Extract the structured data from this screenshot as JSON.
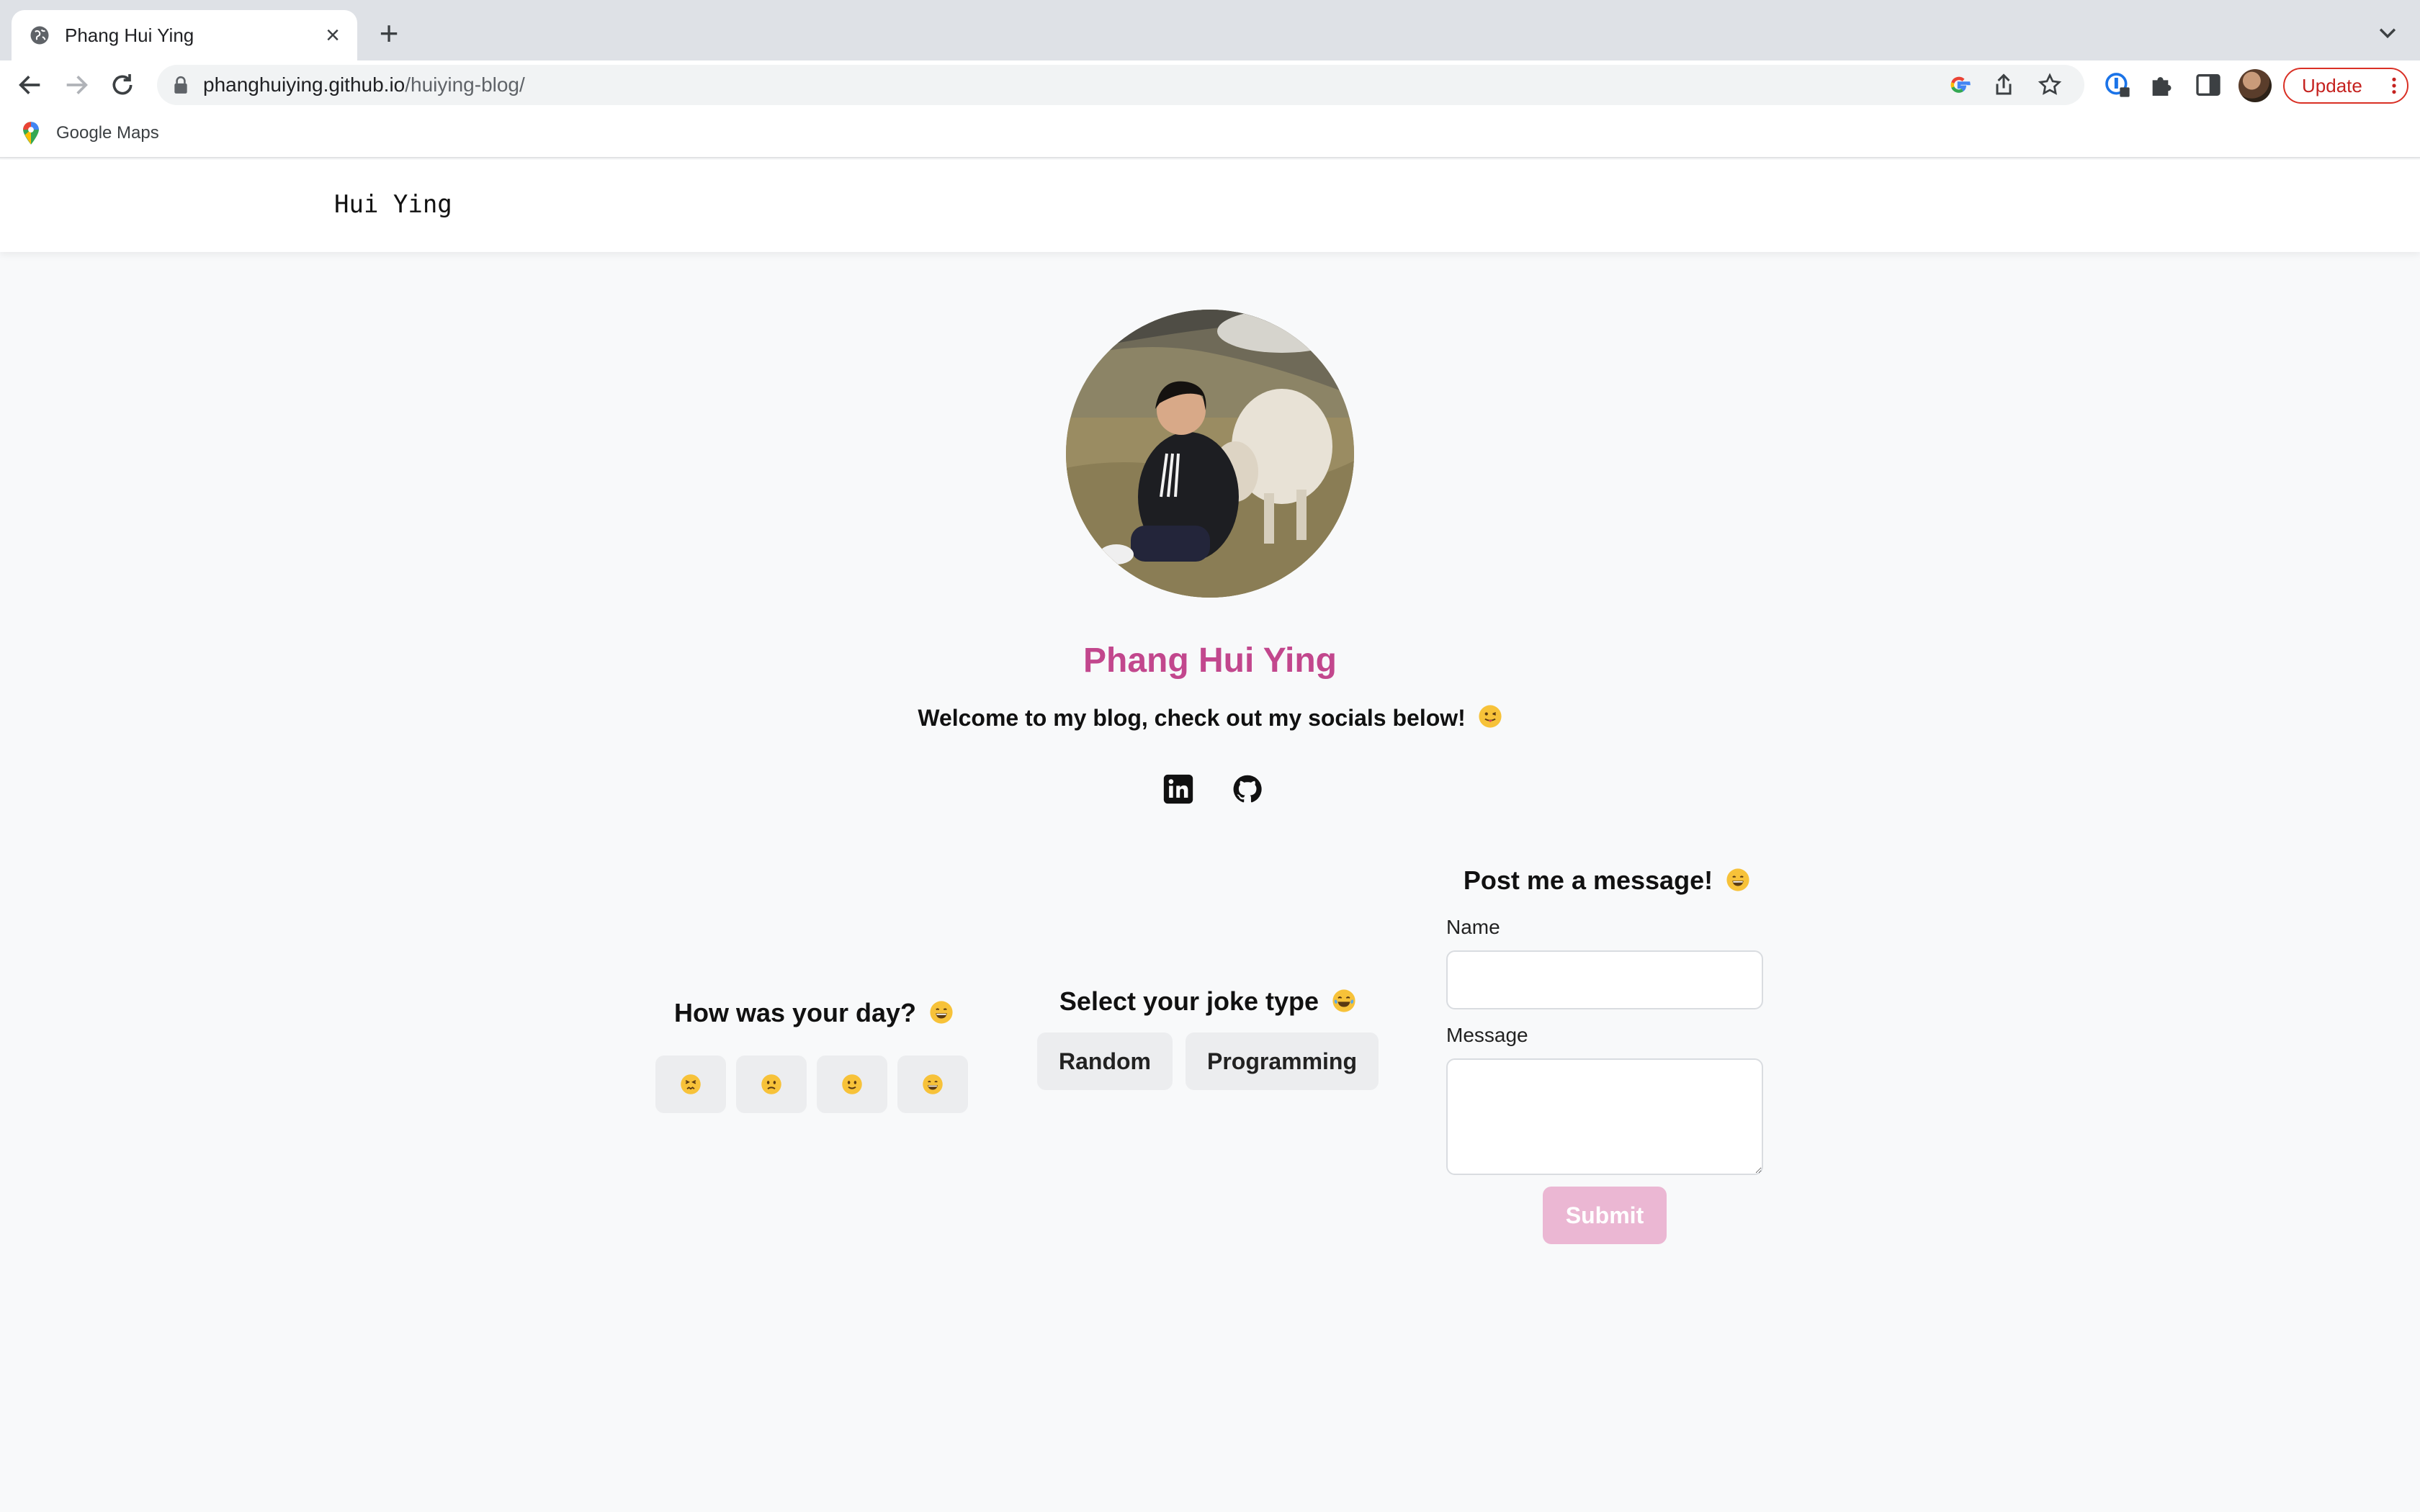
{
  "browser": {
    "tab_title": "Phang Hui Ying",
    "url_host": "phanghuiying.github.io",
    "url_path": "/huiying-blog/",
    "update_label": "Update",
    "bookmark_label": "Google Maps"
  },
  "header": {
    "site_title": "Hui Ying"
  },
  "profile": {
    "name": "Phang Hui Ying",
    "name_color": "#c2478d",
    "welcome": "Welcome to my blog, check out my socials below!"
  },
  "socials": [
    "linkedin-icon",
    "github-icon"
  ],
  "mood": {
    "title": "How was your day?",
    "options": [
      "persevering-face",
      "slightly-frowning-face",
      "slightly-smiling-face",
      "grinning-face"
    ]
  },
  "jokes": {
    "title": "Select your joke type",
    "random_label": "Random",
    "programming_label": "Programming"
  },
  "message_form": {
    "title": "Post me a message!",
    "name_label": "Name",
    "name_value": "",
    "message_label": "Message",
    "message_value": "",
    "submit_label": "Submit",
    "submit_color": "#ebb7d3"
  }
}
